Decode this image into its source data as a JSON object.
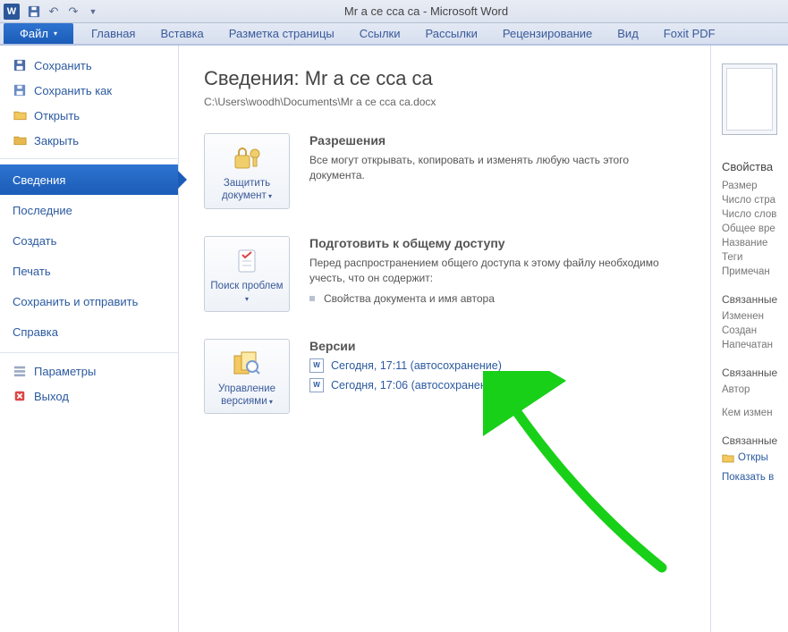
{
  "title": "Mr a ce  cca ca  -  Microsoft Word",
  "tabs": {
    "file": "Файл",
    "home": "Главная",
    "insert": "Вставка",
    "layout": "Разметка страницы",
    "refs": "Ссылки",
    "mail": "Рассылки",
    "review": "Рецензирование",
    "view": "Вид",
    "foxit": "Foxit PDF"
  },
  "sidebar": {
    "save": "Сохранить",
    "saveas": "Сохранить как",
    "open": "Открыть",
    "close": "Закрыть",
    "info": "Сведения",
    "recent": "Последние",
    "new": "Создать",
    "print": "Печать",
    "share": "Сохранить и отправить",
    "help": "Справка",
    "options": "Параметры",
    "exit": "Выход"
  },
  "content": {
    "heading": "Сведения: Mr a ce  cca ca",
    "path": "C:\\Users\\woodh\\Documents\\Mr a ce  cca ca.docx",
    "perm": {
      "btn": "Защитить документ",
      "title": "Разрешения",
      "text": "Все могут открывать, копировать и изменять любую часть этого документа."
    },
    "prep": {
      "btn": "Поиск проблем",
      "title": "Подготовить к общему доступу",
      "text": "Перед распространением общего доступа к этому файлу необходимо учесть, что он содержит:",
      "bullet": "Свойства документа и имя автора"
    },
    "versions": {
      "btn": "Управление версиями",
      "title": "Версии",
      "v1": "Сегодня, 17:11 (автосохранение)",
      "v2": "Сегодня, 17:06 (автосохранение)"
    }
  },
  "info": {
    "props": "Свойства",
    "size": "Размер",
    "pages": "Число стра",
    "words": "Число слов",
    "edit_time": "Общее вре",
    "name": "Название",
    "tags": "Теги",
    "notes": "Примечан",
    "related": "Связанные",
    "modified": "Изменен",
    "created": "Создан",
    "printed": "Напечатан",
    "related2": "Связанные",
    "author": "Автор",
    "modby": "Кем измен",
    "related3": "Связанные",
    "open": "Откры",
    "showall": "Показать в"
  }
}
